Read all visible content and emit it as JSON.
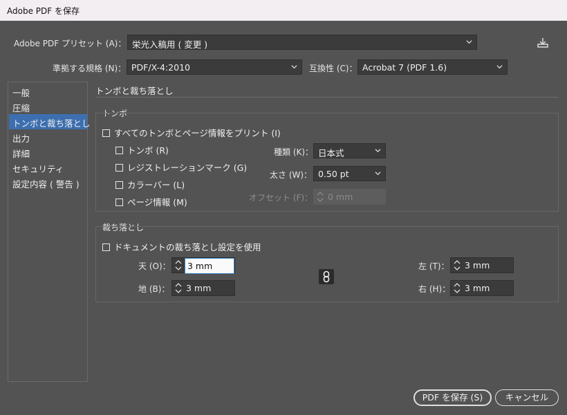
{
  "window": {
    "title": "Adobe PDF を保存"
  },
  "preset": {
    "label": "Adobe PDF プリセット (A)：",
    "value": "栄光入稿用 ( 変更 )"
  },
  "standard": {
    "label": "準拠する規格 (N)：",
    "value": "PDF/X-4:2010"
  },
  "compat": {
    "label": "互換性 (C)：",
    "value": "Acrobat 7 (PDF 1.6)"
  },
  "sidebar": {
    "items": [
      {
        "label": "一般"
      },
      {
        "label": "圧縮"
      },
      {
        "label": "トンボと裁ち落とし"
      },
      {
        "label": "出力"
      },
      {
        "label": "詳細"
      },
      {
        "label": "セキュリティ"
      },
      {
        "label": "設定内容 ( 警告 )"
      }
    ]
  },
  "section": {
    "title": "トンボと裁ち落とし"
  },
  "marks": {
    "group_label": "トンボ",
    "all_marks": "すべてのトンボとページ情報をプリント (I)",
    "trim": "トンボ (R)",
    "registration": "レジストレーションマーク (G)",
    "color_bars": "カラーバー (L)",
    "page_info": "ページ情報 (M)",
    "type_label": "種類 (K)：",
    "type_value": "日本式",
    "weight_label": "太さ (W)：",
    "weight_value": "0.50 pt",
    "offset_label": "オフセット (F)：",
    "offset_value": "0 mm"
  },
  "bleed": {
    "group_label": "裁ち落とし",
    "use_doc": "ドキュメントの裁ち落とし設定を使用",
    "top_label": "天 (O)：",
    "top_value": "3 mm",
    "bottom_label": "地 (B)：",
    "bottom_value": "3 mm",
    "left_label": "左 (T)：",
    "left_value": "3 mm",
    "right_label": "右 (H)：",
    "right_value": "3 mm"
  },
  "buttons": {
    "save": "PDF を保存 (S)",
    "cancel": "キャンセル"
  },
  "colors": {
    "background": "#535353",
    "accent": "#3d6fb0",
    "titlebar": "#f3eef2"
  }
}
